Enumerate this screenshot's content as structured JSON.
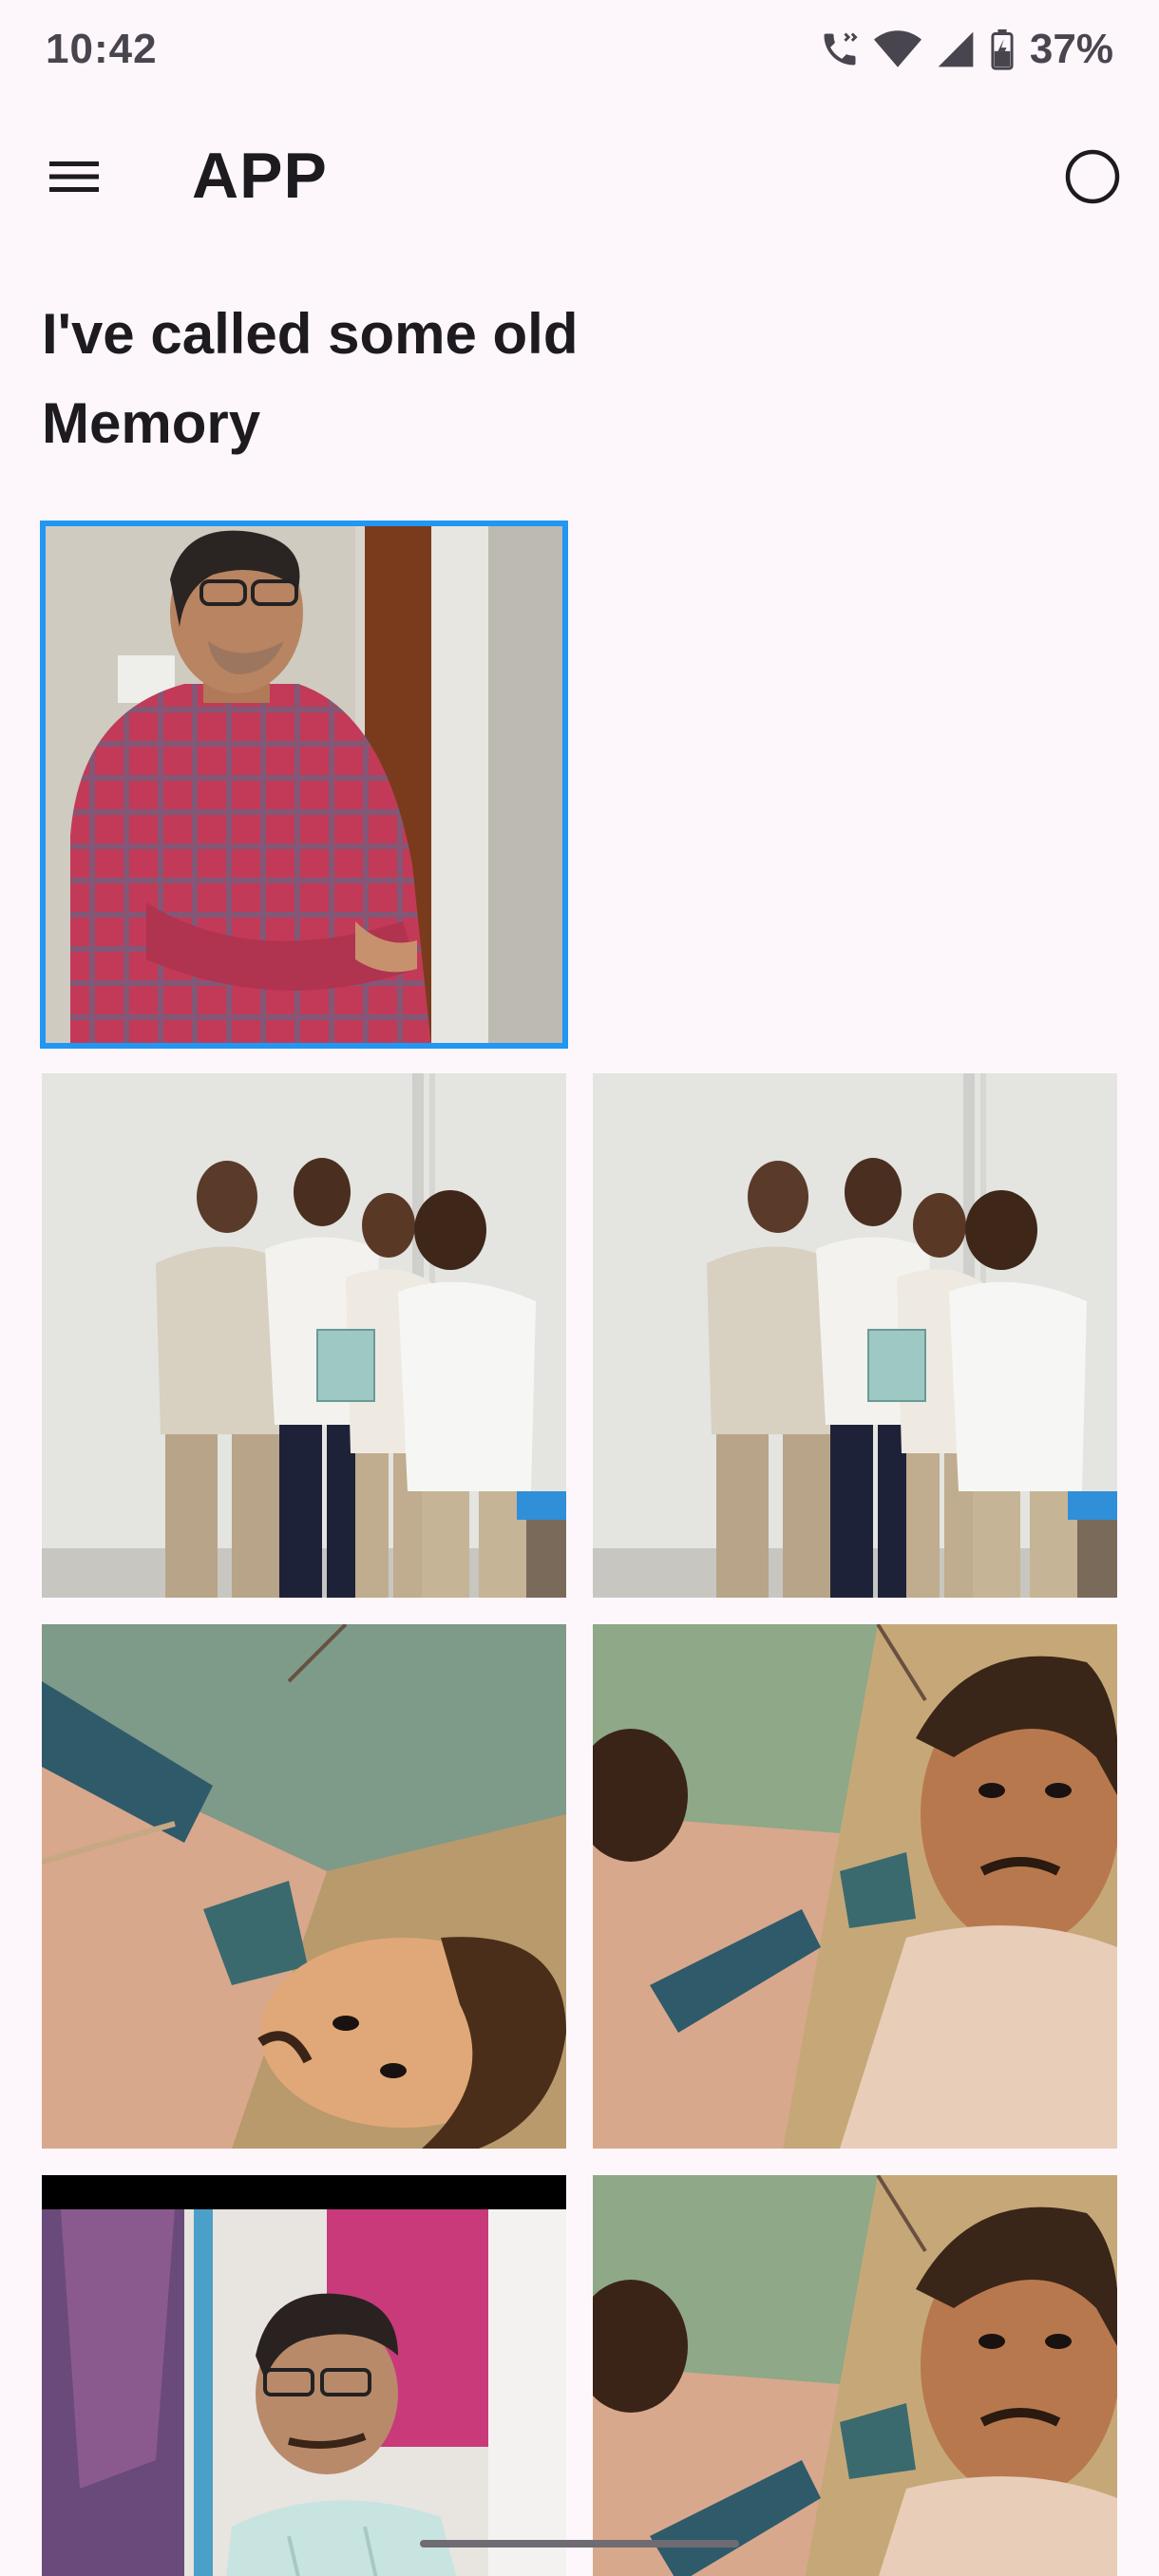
{
  "status_bar": {
    "time": "10:42",
    "battery_percent": "37%",
    "icons": [
      "wifi-calling-icon",
      "wifi-icon",
      "cellular-signal-icon",
      "battery-charging-icon"
    ]
  },
  "app_bar": {
    "title": "APP",
    "menu_icon": "hamburger-menu-icon",
    "profile_icon": "circle-outline-icon"
  },
  "page": {
    "heading": "I've called some old Memory"
  },
  "gallery": {
    "photos": [
      {
        "subject": "man-in-checked-shirt-arms-crossed",
        "selected": true
      },
      {
        "subject": "group-of-four-with-book",
        "selected": false
      },
      {
        "subject": "group-of-four-with-book",
        "selected": false
      },
      {
        "subject": "stylized-selfie-upside-down",
        "selected": false
      },
      {
        "subject": "stylized-selfie",
        "selected": false
      },
      {
        "subject": "man-with-glasses-near-curtains",
        "selected": false
      },
      {
        "subject": "stylized-selfie",
        "selected": false
      }
    ]
  },
  "colors": {
    "background": "#fdf7fc",
    "selection_border": "#2196f3",
    "text_primary": "#1d1b20"
  }
}
